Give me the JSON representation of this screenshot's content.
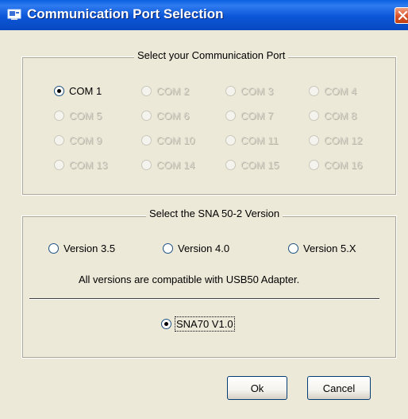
{
  "window": {
    "title": "Communication Port Selection"
  },
  "port_group": {
    "title": "Select your Communication Port",
    "ports": [
      {
        "label": "COM 1",
        "selected": true,
        "enabled": true
      },
      {
        "label": "COM 2",
        "selected": false,
        "enabled": false
      },
      {
        "label": "COM 3",
        "selected": false,
        "enabled": false
      },
      {
        "label": "COM 4",
        "selected": false,
        "enabled": false
      },
      {
        "label": "COM 5",
        "selected": false,
        "enabled": false
      },
      {
        "label": "COM 6",
        "selected": false,
        "enabled": false
      },
      {
        "label": "COM 7",
        "selected": false,
        "enabled": false
      },
      {
        "label": "COM 8",
        "selected": false,
        "enabled": false
      },
      {
        "label": "COM 9",
        "selected": false,
        "enabled": false
      },
      {
        "label": "COM 10",
        "selected": false,
        "enabled": false
      },
      {
        "label": "COM 11",
        "selected": false,
        "enabled": false
      },
      {
        "label": "COM 12",
        "selected": false,
        "enabled": false
      },
      {
        "label": "COM 13",
        "selected": false,
        "enabled": false
      },
      {
        "label": "COM 14",
        "selected": false,
        "enabled": false
      },
      {
        "label": "COM 15",
        "selected": false,
        "enabled": false
      },
      {
        "label": "COM 16",
        "selected": false,
        "enabled": false
      }
    ]
  },
  "version_group": {
    "title": "Select the SNA 50-2 Version",
    "versions": [
      {
        "label": "Version 3.5",
        "selected": false
      },
      {
        "label": "Version 4.0",
        "selected": false
      },
      {
        "label": "Version 5.X",
        "selected": false
      }
    ],
    "note": "All versions are compatible with  USB50 Adapter.",
    "sna70": {
      "label": "SNA70 V1.0",
      "selected": true
    }
  },
  "buttons": {
    "ok": "Ok",
    "cancel": "Cancel"
  }
}
